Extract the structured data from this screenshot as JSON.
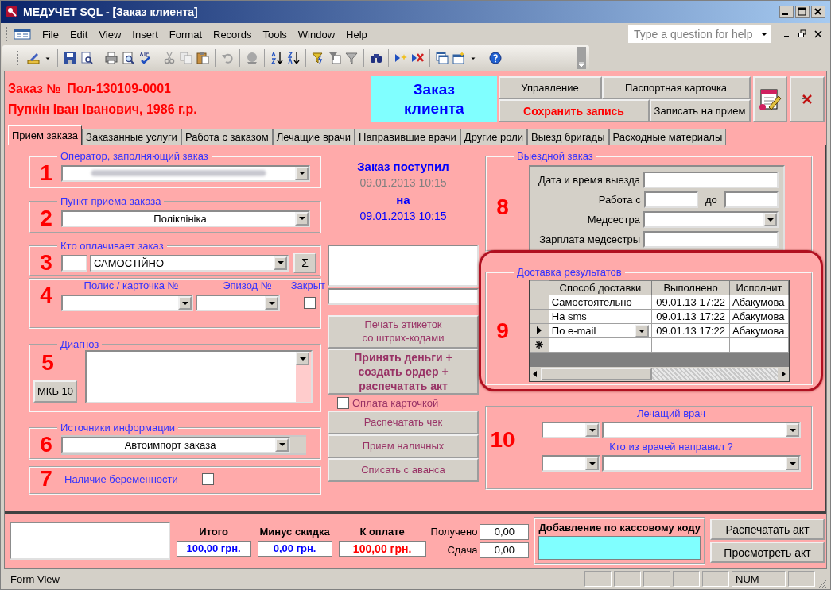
{
  "window": {
    "title": "МЕДУЧЕТ SQL - [Заказ клиента]"
  },
  "menu": [
    "File",
    "Edit",
    "View",
    "Insert",
    "Format",
    "Records",
    "Tools",
    "Window",
    "Help"
  ],
  "help_box": {
    "placeholder": "Type a question for help"
  },
  "header": {
    "order_label": "Заказ №",
    "order_number": "Пол-130109-0001",
    "patient": "Пупкін Іван Іванович, 1986 г.р.",
    "form_title": "Заказ клиента",
    "buttons": [
      {
        "label": "Управление",
        "kind": "normal"
      },
      {
        "label": "Паспортная карточка",
        "kind": "normal"
      },
      {
        "label": "Сохранить запись",
        "kind": "primary"
      },
      {
        "label": "Записать на прием",
        "kind": "normal"
      }
    ]
  },
  "tabs": [
    {
      "label": "Прием заказа",
      "selected": true
    },
    {
      "label": "Заказанные услуги",
      "selected": false
    },
    {
      "label": "Работа с заказом",
      "selected": false
    },
    {
      "label": "Лечащие врачи",
      "selected": false
    },
    {
      "label": "Направившие врачи",
      "selected": false
    },
    {
      "label": "Другие роли",
      "selected": false
    },
    {
      "label": "Выезд бригады",
      "selected": false
    },
    {
      "label": "Расходные материалы",
      "selected": false
    }
  ],
  "operator": {
    "number": "1",
    "legend": "Оператор, заполняющий заказ"
  },
  "reception_point": {
    "number": "2",
    "legend": "Пункт приема заказа",
    "value": "Поліклініка"
  },
  "payer": {
    "number": "3",
    "legend": "Кто оплачивает заказ",
    "value": "САМОСТІЙНО",
    "button": "Σ"
  },
  "policy": {
    "number": "4",
    "policy_label": "Полис / карточка №",
    "episode_label": "Эпизод №",
    "closed_label": "Закрыт",
    "closed": false
  },
  "diagnosis": {
    "number": "5",
    "legend": "Диагноз",
    "button": "МКБ 10"
  },
  "info_sources": {
    "number": "6",
    "legend": "Источники информации",
    "value": "Автоимпорт заказа"
  },
  "pregnancy": {
    "number": "7",
    "label": "Наличие беременности",
    "checked": false
  },
  "order_received": {
    "title": "Заказ поступил",
    "received": "09.01.2013 10:15",
    "for_label": "на",
    "scheduled": "09.01.2013 10:15"
  },
  "actions": {
    "print_labels": "Печать этикеток\nсо штрих-кодами",
    "accept_money": "Принять деньги +\nсоздать ордер +\nраспечатать акт",
    "card_payment": {
      "label": "Оплата карточкой",
      "checked": false
    },
    "buttons": [
      "Распечатать чек",
      "Прием наличных",
      "Списать с аванса"
    ]
  },
  "field_visit": {
    "number": "8",
    "legend": "Выездной заказ",
    "datetime_label": "Дата и время выезда",
    "work_from_label": "Работа с",
    "work_to_label": "до",
    "nurse_label": "Медсестра",
    "nurse_pay_label": "Зарплата медсестры"
  },
  "delivery": {
    "number": "9",
    "legend": "Доставка результатов",
    "highlighted": true,
    "columns": [
      "Способ доставки",
      "Выполнено",
      "Исполнит"
    ],
    "rows": [
      {
        "cells": [
          "Самостоятельно",
          "09.01.13 17:22",
          "Абакумова"
        ],
        "selected": false
      },
      {
        "cells": [
          "На sms",
          "09.01.13 17:22",
          "Абакумова"
        ],
        "selected": false
      },
      {
        "cells": [
          "По e-mail",
          "09.01.13 17:22",
          "Абакумова"
        ],
        "selected": true
      }
    ]
  },
  "doctors": {
    "number": "10",
    "attending_label": "Лечащий врач",
    "referring_label": "Кто из врачей направил ?"
  },
  "totals": {
    "total_label": "Итого",
    "total": "100,00 грн.",
    "discount_label": "Минус скидка",
    "discount": "0,00 грн.",
    "due_label": "К оплате",
    "due": "100,00 грн.",
    "received_label": "Получено",
    "received": "0,00",
    "change_label": "Сдача",
    "change": "0,00"
  },
  "cash_code": {
    "label": "Добавление по кассовому коду"
  },
  "report_buttons": [
    "Распечатать акт",
    "Просмотреть акт"
  ],
  "status_bar": {
    "mode": "Form View",
    "num": "NUM"
  }
}
